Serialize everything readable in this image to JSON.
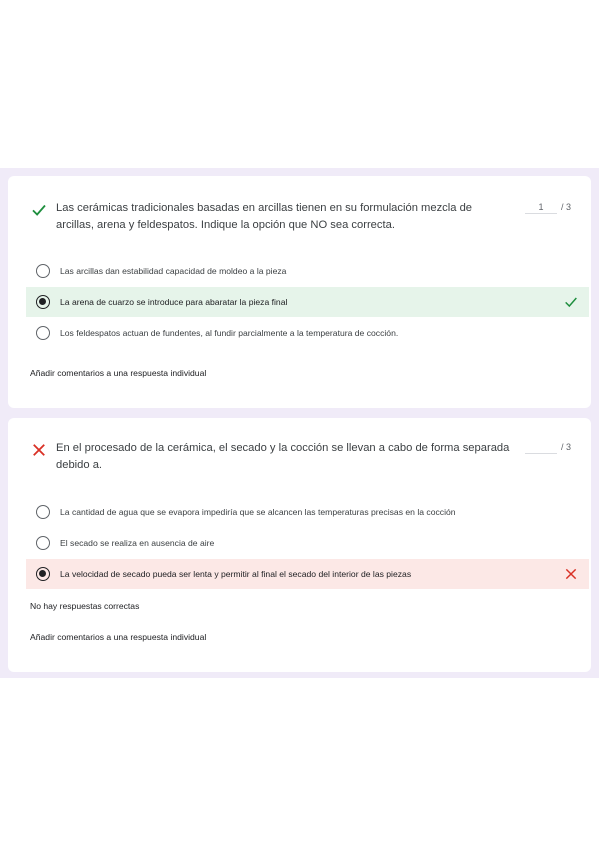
{
  "questions": [
    {
      "status": "correct",
      "title": "Las cerámicas tradicionales basadas en arcillas tienen en su formulación mezcla de arcillas, arena y feldespatos. Indique la opción que NO sea correcta.",
      "score_value": "1",
      "score_total": "/ 3",
      "options": [
        {
          "label": "Las arcillas dan estabilidad capacidad de moldeo a la pieza",
          "selected": false,
          "result": ""
        },
        {
          "label": "La arena de cuarzo se introduce para abaratar la pieza final",
          "selected": true,
          "result": "correct"
        },
        {
          "label": "Los feldespatos actuan de fundentes, al fundir parcialmente a la temperatura de cocción.",
          "selected": false,
          "result": ""
        }
      ],
      "no_correct_note": "",
      "feedback_link": "Añadir comentarios a una respuesta individual"
    },
    {
      "status": "incorrect",
      "title": "En el procesado de la cerámica, el secado y la cocción se llevan a cabo de forma separada debido a.",
      "score_value": "",
      "score_total": "/ 3",
      "options": [
        {
          "label": "La cantidad de agua que se evapora impediría que se alcancen las temperaturas precisas en la cocción",
          "selected": false,
          "result": ""
        },
        {
          "label": "El secado se realiza en ausencia de aire",
          "selected": false,
          "result": ""
        },
        {
          "label": "La velocidad de secado pueda ser lenta y permitir al final el secado del interior de las piezas",
          "selected": true,
          "result": "incorrect"
        }
      ],
      "no_correct_note": "No hay respuestas correctas",
      "feedback_link": "Añadir comentarios a una respuesta individual"
    }
  ],
  "icons": {
    "correct": "check-icon",
    "incorrect": "x-icon",
    "radio_checked": "radio-checked-icon",
    "radio_unchecked": "radio-unchecked-icon"
  },
  "colors": {
    "band": "#f0ebf8",
    "correct": "#1e8e3e",
    "incorrect": "#d93025",
    "correct_bg": "#e6f4ea",
    "incorrect_bg": "#fce8e6"
  }
}
